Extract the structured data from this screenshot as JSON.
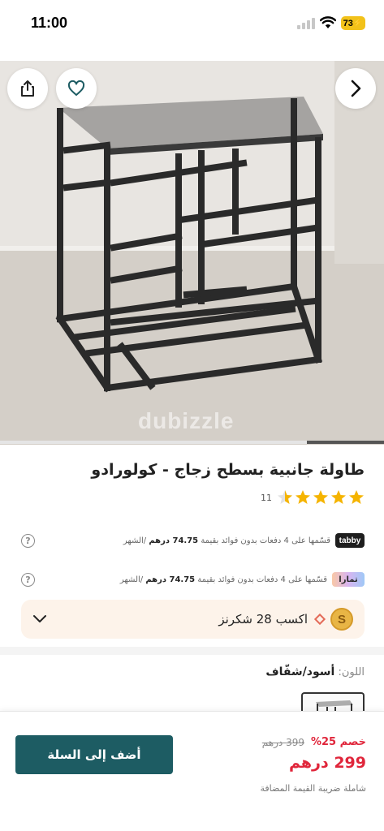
{
  "status_bar": {
    "time": "11:00",
    "battery": "73"
  },
  "hero": {
    "watermark": "dubizzle",
    "share_icon": "share-icon",
    "favorite_icon": "heart-icon",
    "next_icon": "chevron-right-icon",
    "gallery_progress": 0.2
  },
  "product": {
    "title": "طاولة جانبية بسطح زجاج - كولورادو",
    "rating": 4.5,
    "rating_count": "11"
  },
  "payments": [
    {
      "logo": "tabby",
      "text_before": "قسّمها على 4 دفعات بدون فوائد بقيمة",
      "amount": "74.75 درهم",
      "text_after": "/الشهر"
    },
    {
      "logo": "تمارا",
      "text_before": "قسّمها على 4 دفعات بدون فوائد بقيمة",
      "amount": "74.75 درهم",
      "text_after": "/الشهر"
    }
  ],
  "shukran": {
    "text": "اكسب 28 شكرنز",
    "coin": "S"
  },
  "color": {
    "label": "اللون:",
    "value": "أسود/شفّاف"
  },
  "cart": {
    "add_label": "أضف إلى السلة",
    "old_price": "399 درهم",
    "discount": "خصم 25%",
    "new_price": "299 درهم",
    "vat_note": "شاملة ضريبة القيمة المضافة"
  },
  "colors": {
    "accent": "#1d5c63",
    "sale": "#e0263b",
    "star": "#f5b400"
  }
}
